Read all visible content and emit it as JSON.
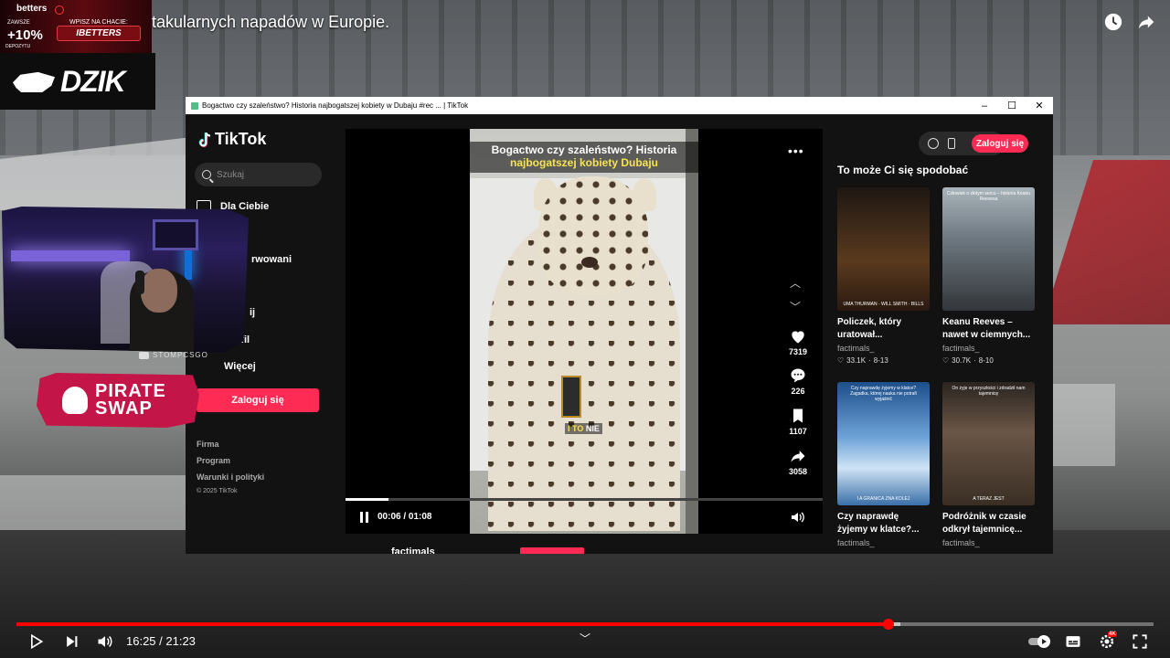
{
  "youtube": {
    "title": "takularnych napadów w Europie.",
    "current_time": "16:25",
    "duration": "21:23",
    "time_display": "16:25 / 21:23",
    "progress_fraction": 0.767,
    "icons": [
      "watch-later-icon",
      "share-icon",
      "play-icon",
      "next-icon",
      "volume-icon",
      "autoplay-toggle-icon",
      "subtitles-icon",
      "settings-icon",
      "fullscreen-icon"
    ],
    "settings_badge": "4K"
  },
  "overlays": {
    "betters": {
      "brand": "betters",
      "zawsze": "ZAWSZE",
      "percent": "+10%",
      "depozyt": "DEPOZYTU",
      "promo_line": "WPISZ NA CHACIE:",
      "code": "IBETTERS"
    },
    "dzik": {
      "word": "DZIK"
    },
    "webcam_tag": "STOMPCSGO",
    "pirate": {
      "line1": "PIRATE",
      "line2": "SWAP"
    }
  },
  "window": {
    "title": "Bogactwo czy szaleństwo? Historia najbogatszej kobiety w Dubaju #rec ... | TikTok",
    "controls": {
      "minimize": "–",
      "maximize": "☐",
      "close": "✕"
    }
  },
  "tiktok": {
    "logo": "TikTok",
    "search_placeholder": "Szukaj",
    "nav": [
      {
        "label": "Dla Ciebie"
      },
      {
        "label": "j"
      },
      {
        "label": "rwowani"
      },
      {
        "label": "ij"
      },
      {
        "label": "Profil"
      },
      {
        "label": "Więcej"
      }
    ],
    "login_side": "Zaloguj się",
    "footer": [
      "Firma",
      "Program",
      "Warunki i polityki"
    ],
    "copyright": "© 2025 TikTok",
    "video": {
      "caption_line1": "Bogactwo czy szaleństwo? Historia",
      "caption_line2": "najbogatszej kobiety Dubaju",
      "subtitle_a": "I TO",
      "subtitle_b": " NIE",
      "time": "00:06 / 01:08",
      "progress_fraction": 0.09,
      "likes": "7319",
      "comments": "226",
      "saves": "1107",
      "shares": "3058"
    },
    "author": "factimals",
    "login_top": "Zaloguj się",
    "recommend_title": "To może Ci się spodobać",
    "recommendations": [
      {
        "caption_l1": "Policzek, który",
        "caption_l2": "uratował...",
        "author": "factimals_",
        "views": "33.1K",
        "duration": "8-13",
        "thumb_bottom": "UMA THURMAN · WILL SMITH · BILLS",
        "accent": "#5a3a1e"
      },
      {
        "caption_l1": "Keanu Reeves –",
        "caption_l2": "nawet w ciemnych...",
        "author": "factimals_",
        "views": "30.7K",
        "duration": "8-10",
        "thumb_top": "Człowiek o złotym sercu – historia Keanu Reevesa",
        "accent": "#7a8a96"
      },
      {
        "caption_l1": "Czy naprawdę",
        "caption_l2": "żyjemy w klatce?...",
        "author": "factimals_",
        "thumb_top": "Czy naprawdę żyjemy w klatce? Zagadka, której nauka nie potrafi wyjaśnić",
        "thumb_bottom": "I A GRANICA ZNA KOLEJ",
        "accent": "#3f78b8"
      },
      {
        "caption_l1": "Podróżnik w czasie",
        "caption_l2": "odkrył tajemnicę...",
        "author": "factimals_",
        "thumb_top": "On żyje w przyszłości i zdradził nam tajemnicę",
        "thumb_bottom": "A TERAZ JEST",
        "accent": "#4a3a2e"
      }
    ]
  }
}
